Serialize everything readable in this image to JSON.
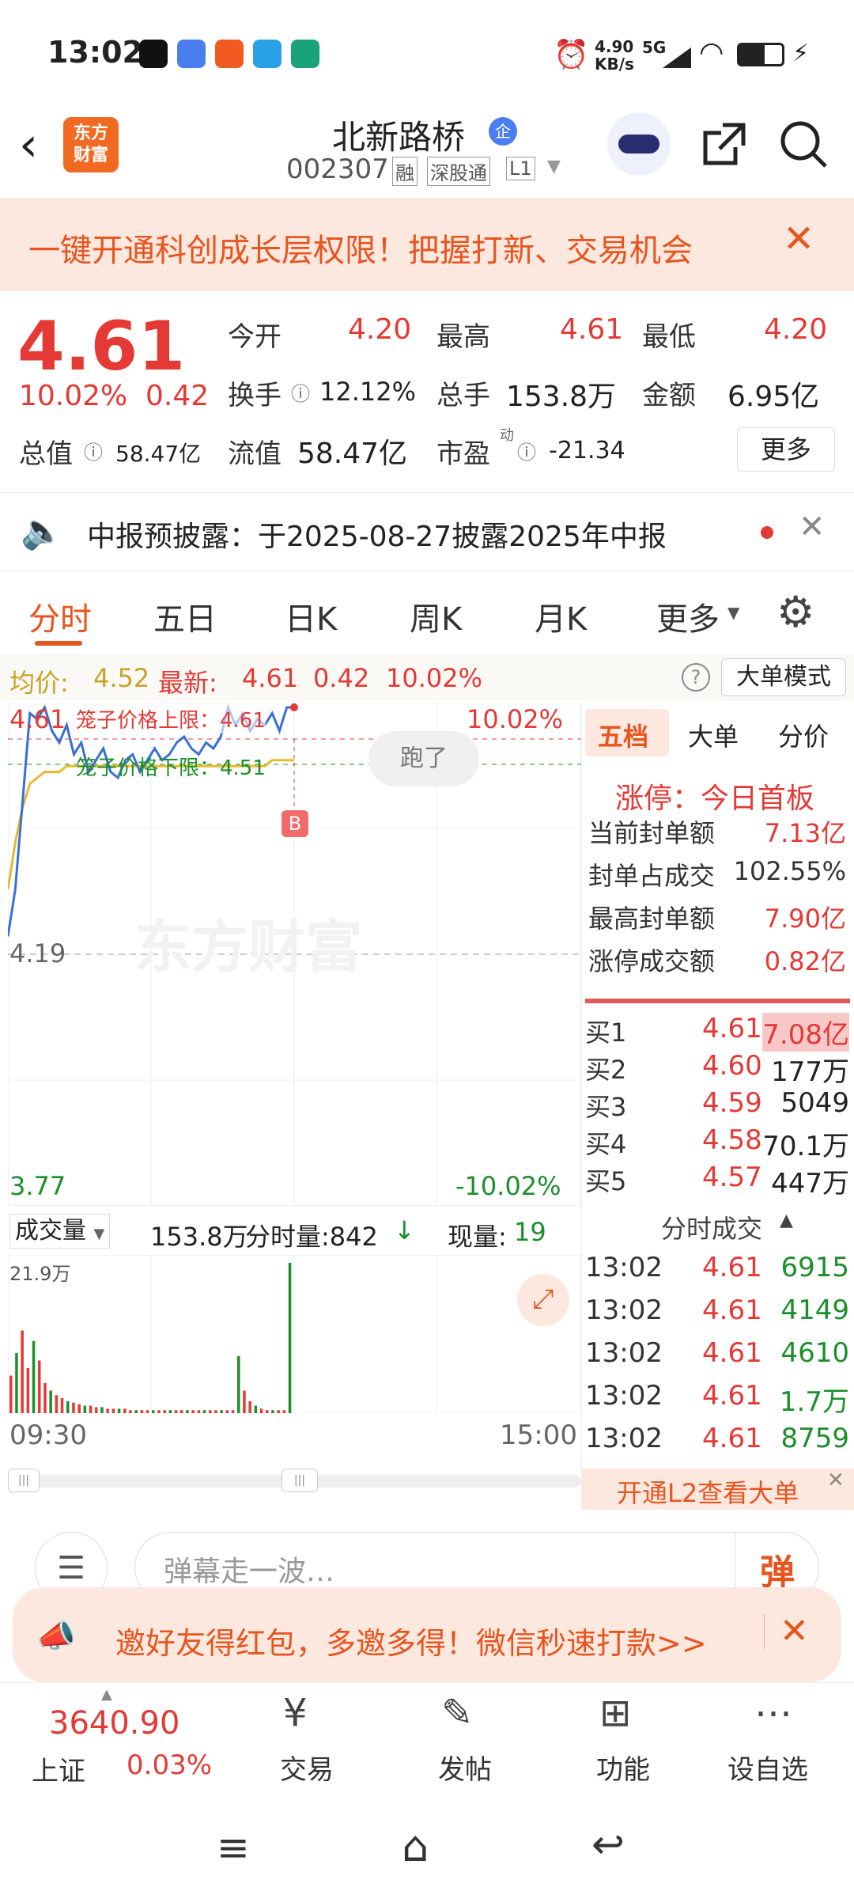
{
  "status_bar": {
    "time": "13:02",
    "net_speed": "4.90",
    "net_unit": "KB/s",
    "signal": "5G"
  },
  "header": {
    "logo_line1": "东方",
    "logo_line2": "财富",
    "stock_name": "北新路桥",
    "badge": "企",
    "code": "002307",
    "tags": [
      "融",
      "深股通",
      "L1"
    ]
  },
  "banner": {
    "text": "一键开通科创成长层权限！把握打新、交易机会"
  },
  "quote": {
    "price": "4.61",
    "change_pct": "10.02%",
    "change": "0.42",
    "open_label": "今开",
    "open": "4.20",
    "high_label": "最高",
    "high": "4.61",
    "low_label": "最低",
    "low": "4.20",
    "turnover_label": "换手",
    "turnover": "12.12%",
    "volume_label": "总手",
    "volume": "153.8万",
    "amount_label": "金额",
    "amount": "6.95亿",
    "mcap_label": "总值",
    "mcap": "58.47亿",
    "float_label": "流值",
    "float": "58.47亿",
    "pe_label": "市盈",
    "pe_sup": "动",
    "pe": "-21.34",
    "more": "更多"
  },
  "notice": {
    "text": "中报预披露：于2025-08-27披露2025年中报"
  },
  "tabs": [
    "分时",
    "五日",
    "日K",
    "周K",
    "月K",
    "更多"
  ],
  "infobar": {
    "avg_label": "均价:",
    "avg": "4.52",
    "latest_label": "最新:",
    "latest": "4.61",
    "change": "0.42",
    "pct": "10.02%",
    "mode": "大单模式"
  },
  "chart": {
    "top_price": "4.61",
    "top_pct": "10.02%",
    "mid_price": "4.19",
    "bottom_price": "3.77",
    "bottom_pct": "-10.02%",
    "upper_label": "笼子价格上限：4.61",
    "lower_label": "笼子价格下限：4.51",
    "bubble": "跑了",
    "b_marker": "B",
    "watermark": "东方财富",
    "price_line": [
      4.22,
      4.3,
      4.45,
      4.6,
      4.59,
      4.61,
      4.57,
      4.55,
      4.58,
      4.53,
      4.55,
      4.5,
      4.52,
      4.54,
      4.5,
      4.49,
      4.52,
      4.53,
      4.5,
      4.52,
      4.54,
      4.52,
      4.53,
      4.55,
      4.56,
      4.54,
      4.53,
      4.55,
      4.54,
      4.56,
      4.61,
      4.58,
      4.6,
      4.57,
      4.59,
      4.58,
      4.6,
      4.57,
      4.61,
      4.61
    ],
    "avg_line": [
      4.3,
      4.38,
      4.44,
      4.48,
      4.49,
      4.5,
      4.5,
      4.5,
      4.51,
      4.51,
      4.51,
      4.51,
      4.51,
      4.51,
      4.51,
      4.51,
      4.51,
      4.51,
      4.51,
      4.51,
      4.51,
      4.51,
      4.51,
      4.51,
      4.51,
      4.51,
      4.51,
      4.51,
      4.51,
      4.51,
      4.51,
      4.51,
      4.51,
      4.51,
      4.51,
      4.51,
      4.52,
      4.52,
      4.52,
      4.52
    ]
  },
  "volume": {
    "label": "成交量",
    "total": "153.8万",
    "minute_label": "分时量:842",
    "now_label": "现量:",
    "now": "19",
    "max": "21.9万",
    "start": "09:30",
    "end": "15:00",
    "bars": [
      0.25,
      0.4,
      0.55,
      0.3,
      0.48,
      0.35,
      0.2,
      0.15,
      0.12,
      0.1,
      0.08,
      0.07,
      0.06,
      0.05,
      0.05,
      0.04,
      0.04,
      0.03,
      0.03,
      0.03,
      0.03,
      0.02,
      0.02,
      0.02,
      0.02,
      0.02,
      0.02,
      0.02,
      0.02,
      0.02,
      0.02,
      0.02,
      0.02,
      0.02,
      0.02,
      0.02,
      0.02,
      0.02,
      0.02,
      0.02,
      0.38,
      0.15,
      0.08,
      0.05,
      0.03,
      0.02,
      0.02,
      0.02,
      0.02,
      1.0
    ]
  },
  "right": {
    "tabs": [
      "五档",
      "大单",
      "分价"
    ],
    "limit_title": "涨停：今日首板",
    "stats": [
      {
        "k": "当前封单额",
        "v": "7.13亿"
      },
      {
        "k": "封单占成交",
        "v": "102.55%"
      },
      {
        "k": "最高封单额",
        "v": "7.90亿"
      },
      {
        "k": "涨停成交额",
        "v": "0.82亿"
      }
    ],
    "bids": [
      {
        "k": "买1",
        "p": "4.61",
        "v": "7.08亿"
      },
      {
        "k": "买2",
        "p": "4.60",
        "v": "177万"
      },
      {
        "k": "买3",
        "p": "4.59",
        "v": "5049"
      },
      {
        "k": "买4",
        "p": "4.58",
        "v": "70.1万"
      },
      {
        "k": "买5",
        "p": "4.57",
        "v": "447万"
      }
    ],
    "ticks_title": "分时成交",
    "ticks": [
      {
        "t": "13:02",
        "p": "4.61",
        "v": "6915"
      },
      {
        "t": "13:02",
        "p": "4.61",
        "v": "4149"
      },
      {
        "t": "13:02",
        "p": "4.61",
        "v": "4610"
      },
      {
        "t": "13:02",
        "p": "4.61",
        "v": "1.7万"
      },
      {
        "t": "13:02",
        "p": "4.61",
        "v": "8759"
      }
    ],
    "l2": "开通L2查看大单"
  },
  "input": {
    "placeholder": "弹幕走一波…",
    "danmu": "弹"
  },
  "promo": {
    "text": "邀好友得红包，多邀多得！微信秒速打款>>"
  },
  "bottom_nav": {
    "index_value": "3640.90",
    "index_name": "上证",
    "index_pct": "0.03%",
    "items": [
      "交易",
      "发帖",
      "功能",
      "设自选"
    ]
  },
  "colors": {
    "up": "#e53935",
    "down": "#1a8f2a",
    "accent": "#f26a21"
  }
}
